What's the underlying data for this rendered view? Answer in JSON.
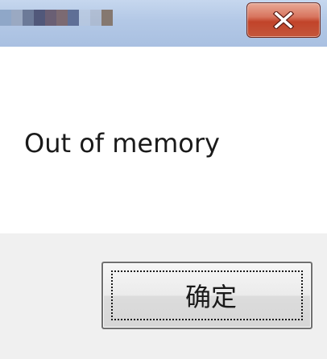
{
  "window": {
    "title_swatches": [
      "#8fa7c8",
      "#9aa9c2",
      "#6c7a98",
      "#51587a",
      "#6a5f74",
      "#7c6a72",
      "#5f6f96",
      "#b7c6dc",
      "#a8b2c4",
      "#857870"
    ],
    "close_icon": "close-icon"
  },
  "message": {
    "text": "Out of memory"
  },
  "buttons": {
    "ok_label": "确定"
  },
  "colors": {
    "titlebar": "#b3c8e6",
    "close_button": "#c1432a",
    "footer": "#f0f0f0"
  }
}
